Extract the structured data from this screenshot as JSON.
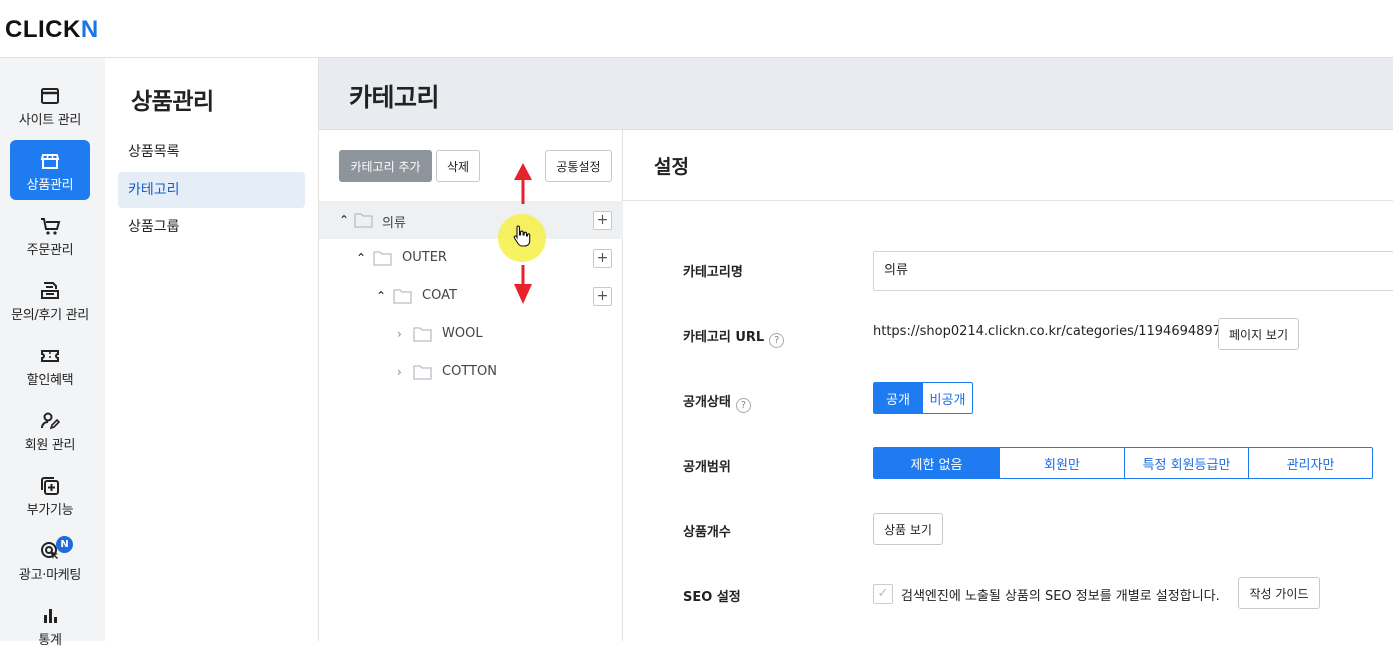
{
  "app": {
    "logo_main": "CLICK",
    "logo_accent": "N"
  },
  "iconbar": {
    "items": [
      {
        "label": "사이트 관리",
        "icon": "browser-window-icon",
        "active": false
      },
      {
        "label": "상품관리",
        "icon": "store-icon",
        "active": true
      },
      {
        "label": "주문관리",
        "icon": "cart-icon",
        "active": false
      },
      {
        "label": "문의/후기 관리",
        "icon": "inbox-icon",
        "active": false
      },
      {
        "label": "할인혜택",
        "icon": "ticket-icon",
        "active": false
      },
      {
        "label": "회원 관리",
        "icon": "user-edit-icon",
        "active": false
      },
      {
        "label": "부가기능",
        "icon": "add-on-icon",
        "active": false
      },
      {
        "label": "광고·마케팅",
        "icon": "target-cursor-icon",
        "active": false,
        "badge": "N"
      },
      {
        "label": "통계",
        "icon": "bar-chart-icon",
        "active": false
      }
    ]
  },
  "submenu": {
    "title": "상품관리",
    "items": [
      {
        "label": "상품목록",
        "active": false
      },
      {
        "label": "카테고리",
        "active": true
      },
      {
        "label": "상품그룹",
        "active": false
      }
    ]
  },
  "main": {
    "title": "카테고리"
  },
  "tree": {
    "add_button": "카테고리 추가",
    "delete_button": "삭제",
    "common_settings_button": "공통설정",
    "nodes": [
      {
        "name": "의류",
        "level": 0,
        "expanded": true,
        "selected": true
      },
      {
        "name": "OUTER",
        "level": 1,
        "expanded": true
      },
      {
        "name": "COAT",
        "level": 2,
        "expanded": true
      },
      {
        "name": "WOOL",
        "level": 3,
        "expanded": false
      },
      {
        "name": "COTTON",
        "level": 3,
        "expanded": false
      }
    ],
    "plus_symbol": "+"
  },
  "settings": {
    "title": "설정",
    "category_name_label": "카테고리명",
    "category_name_value": "의류",
    "category_url_label": "카테고리 URL",
    "category_url_value": "https://shop0214.clickn.co.kr/categories/1194694897",
    "page_view_button": "페이지 보기",
    "visibility_label": "공개상태",
    "visibility_options": [
      "공개",
      "비공개"
    ],
    "visibility_selected": "공개",
    "scope_label": "공개범위",
    "scope_options": [
      "제한 없음",
      "회원만",
      "특정 회원등급만",
      "관리자만"
    ],
    "scope_selected": "제한 없음",
    "product_count_label": "상품개수",
    "product_view_button": "상품 보기",
    "seo_label": "SEO 설정",
    "seo_text": "검색엔진에 노출될 상품의 SEO 정보를 개별로 설정합니다.",
    "seo_guide_button": "작성 가이드",
    "help_symbol": "?",
    "check_symbol": "✓"
  },
  "colors": {
    "accent": "#1e7bf0",
    "arrow": "#e8222a",
    "cursor_highlight": "#f5f046"
  }
}
